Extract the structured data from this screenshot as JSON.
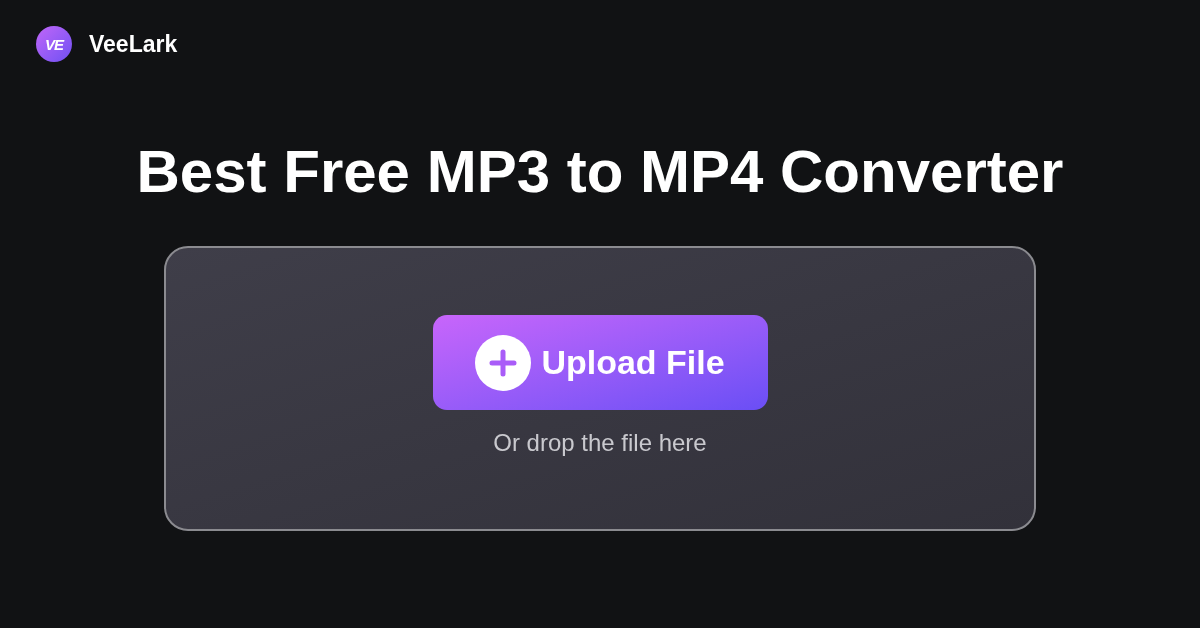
{
  "header": {
    "logo_mark": "VE",
    "brand": "VeeLark"
  },
  "hero": {
    "title": "Best Free MP3 to MP4 Converter"
  },
  "upload": {
    "button": "Upload File",
    "hint": "Or drop the file here"
  }
}
